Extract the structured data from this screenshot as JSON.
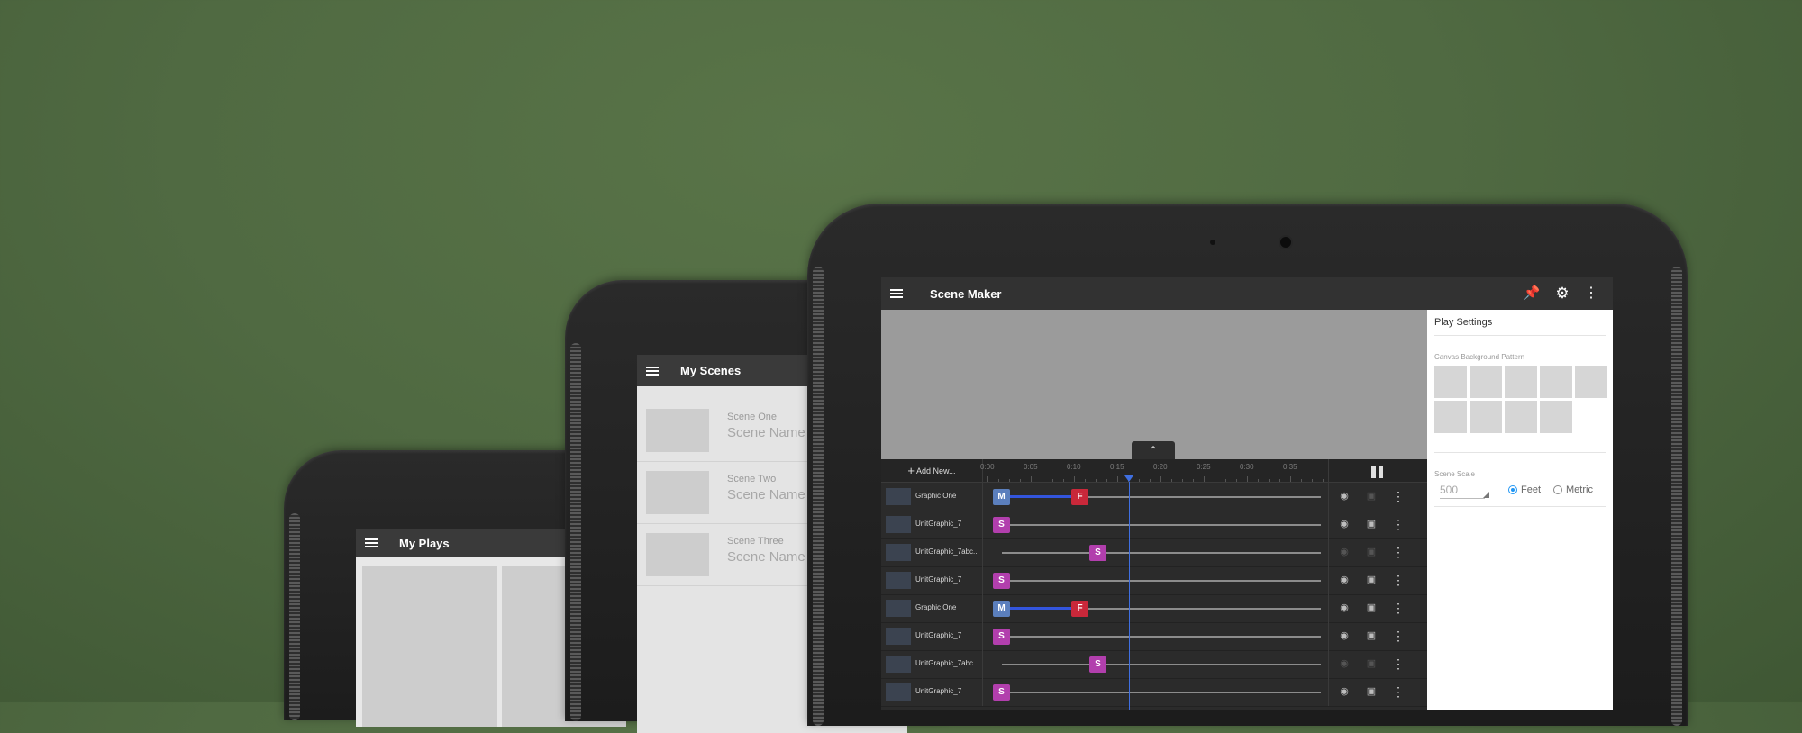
{
  "tablet1": {
    "title": "My Plays"
  },
  "tablet2": {
    "title": "My Scenes",
    "scenes": [
      {
        "label": "Scene One",
        "name": "Scene Name"
      },
      {
        "label": "Scene Two",
        "name": "Scene Name"
      },
      {
        "label": "Scene Three",
        "name": "Scene Name"
      }
    ]
  },
  "tablet3": {
    "title": "Scene Maker",
    "toolbar_icons": [
      "pin-icon",
      "gear-icon",
      "more-vert-icon"
    ],
    "timeline": {
      "add_new": "Add New...",
      "ticks": [
        "0:00",
        "0:05",
        "0:10",
        "0:15",
        "0:20",
        "0:25",
        "0:30",
        "0:35"
      ],
      "tracks": [
        {
          "name": "Graphic One",
          "keys": [
            "M",
            "F"
          ],
          "visible": true,
          "locked": false
        },
        {
          "name": "UnitGraphic_7",
          "keys": [
            "S"
          ],
          "visible": true,
          "locked": true
        },
        {
          "name": "UnitGraphic_7abc...",
          "keys": [
            "S"
          ],
          "visible": false,
          "locked": false
        },
        {
          "name": "UnitGraphic_7",
          "keys": [
            "S"
          ],
          "visible": true,
          "locked": true
        },
        {
          "name": "Graphic One",
          "keys": [
            "M",
            "F"
          ],
          "visible": true,
          "locked": true
        },
        {
          "name": "UnitGraphic_7",
          "keys": [
            "S"
          ],
          "visible": true,
          "locked": true
        },
        {
          "name": "UnitGraphic_7abc...",
          "keys": [
            "S"
          ],
          "visible": false,
          "locked": false
        },
        {
          "name": "UnitGraphic_7",
          "keys": [
            "S"
          ],
          "visible": true,
          "locked": true
        }
      ]
    },
    "settings": {
      "title": "Play Settings",
      "pattern_label": "Canvas Background Pattern",
      "scale_label": "Scene Scale",
      "scale_value": "500",
      "unit_feet": "Feet",
      "unit_metric": "Metric",
      "selected_unit": "Feet"
    },
    "colors": {
      "move": "#5b7fbd",
      "fade": "#c9283a",
      "show": "#b23fad",
      "playhead": "#3f6fe0"
    }
  }
}
